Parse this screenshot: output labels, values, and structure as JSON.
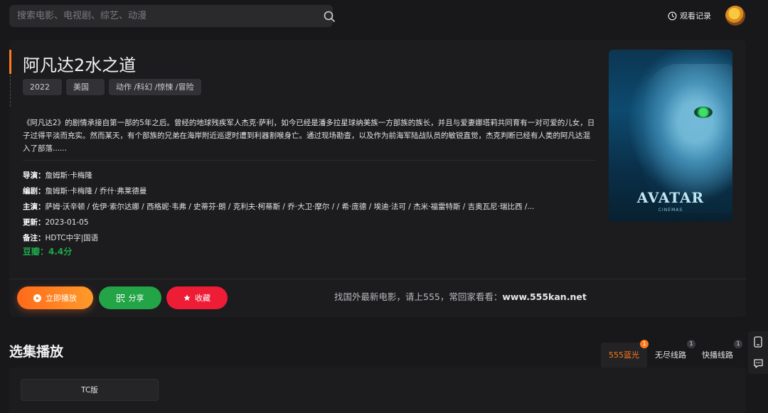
{
  "search": {
    "placeholder": "搜索电影、电视剧、综艺、动漫"
  },
  "header": {
    "history_label": "观看记录"
  },
  "movie": {
    "title": "阿凡达2水之道",
    "year": "2022",
    "country": "美国",
    "genres": [
      "动作 /",
      "科幻 /",
      "惊悚 /",
      "冒险"
    ],
    "description": "《阿凡达2》的剧情承接自第一部的5年之后。曾经的地球残疾军人杰克·萨利，如今已经是潘多拉星球纳美族一方部族的族长，并且与爱妻娜塔莉共同育有一对可爱的儿女，日子过得平淡而充实。然而某天，有个部族的兄弟在海岸附近巡逻时遭到利器割喉身亡。通过现场勘查，以及作为前海军陆战队员的敏锐直觉，杰克判断已经有人类的阿凡达混入了部落......",
    "director_label": "导演：",
    "director": "詹姆斯·卡梅隆",
    "writer_label": "编剧：",
    "writer": "詹姆斯·卡梅隆 / 乔什·弗莱德曼",
    "cast_label": "主演：",
    "cast": "萨姆·沃辛顿 / 佐伊·索尔达娜 / 西格妮·韦弗 / 史蒂芬·朗 / 克利夫·柯蒂斯 / 乔·大卫·摩尔 / / 希·庞德 / 埃迪·法可 / 杰米·福雷特斯 / 吉奥瓦尼·瑞比西 /...",
    "updated_label": "更新：",
    "updated": "2023-01-05",
    "note_label": "备注：",
    "note": "HDTC中字|国语",
    "douban": "豆瓣：4.4分",
    "poster_title": "AVATAR",
    "poster_sub": "CINEMAS"
  },
  "actions": {
    "play_label": "立即播放",
    "share_label": "分享",
    "fav_label": "收藏"
  },
  "promo": {
    "text": "找国外最新电影，请上555，常回家看看：",
    "site": "www.555kan.net"
  },
  "episodes_section": {
    "title": "选集播放",
    "lines": [
      {
        "label": "555蓝光",
        "count": "1"
      },
      {
        "label": "无尽线路",
        "count": "1"
      },
      {
        "label": "快播线路",
        "count": "1"
      }
    ],
    "episodes": [
      "TC版"
    ]
  },
  "colors": {
    "accent": "#ff7a1a",
    "share_green": "#22a447",
    "fav_red": "#ee1c35",
    "douban_green": "#1ea94a",
    "background": "#18181a"
  }
}
